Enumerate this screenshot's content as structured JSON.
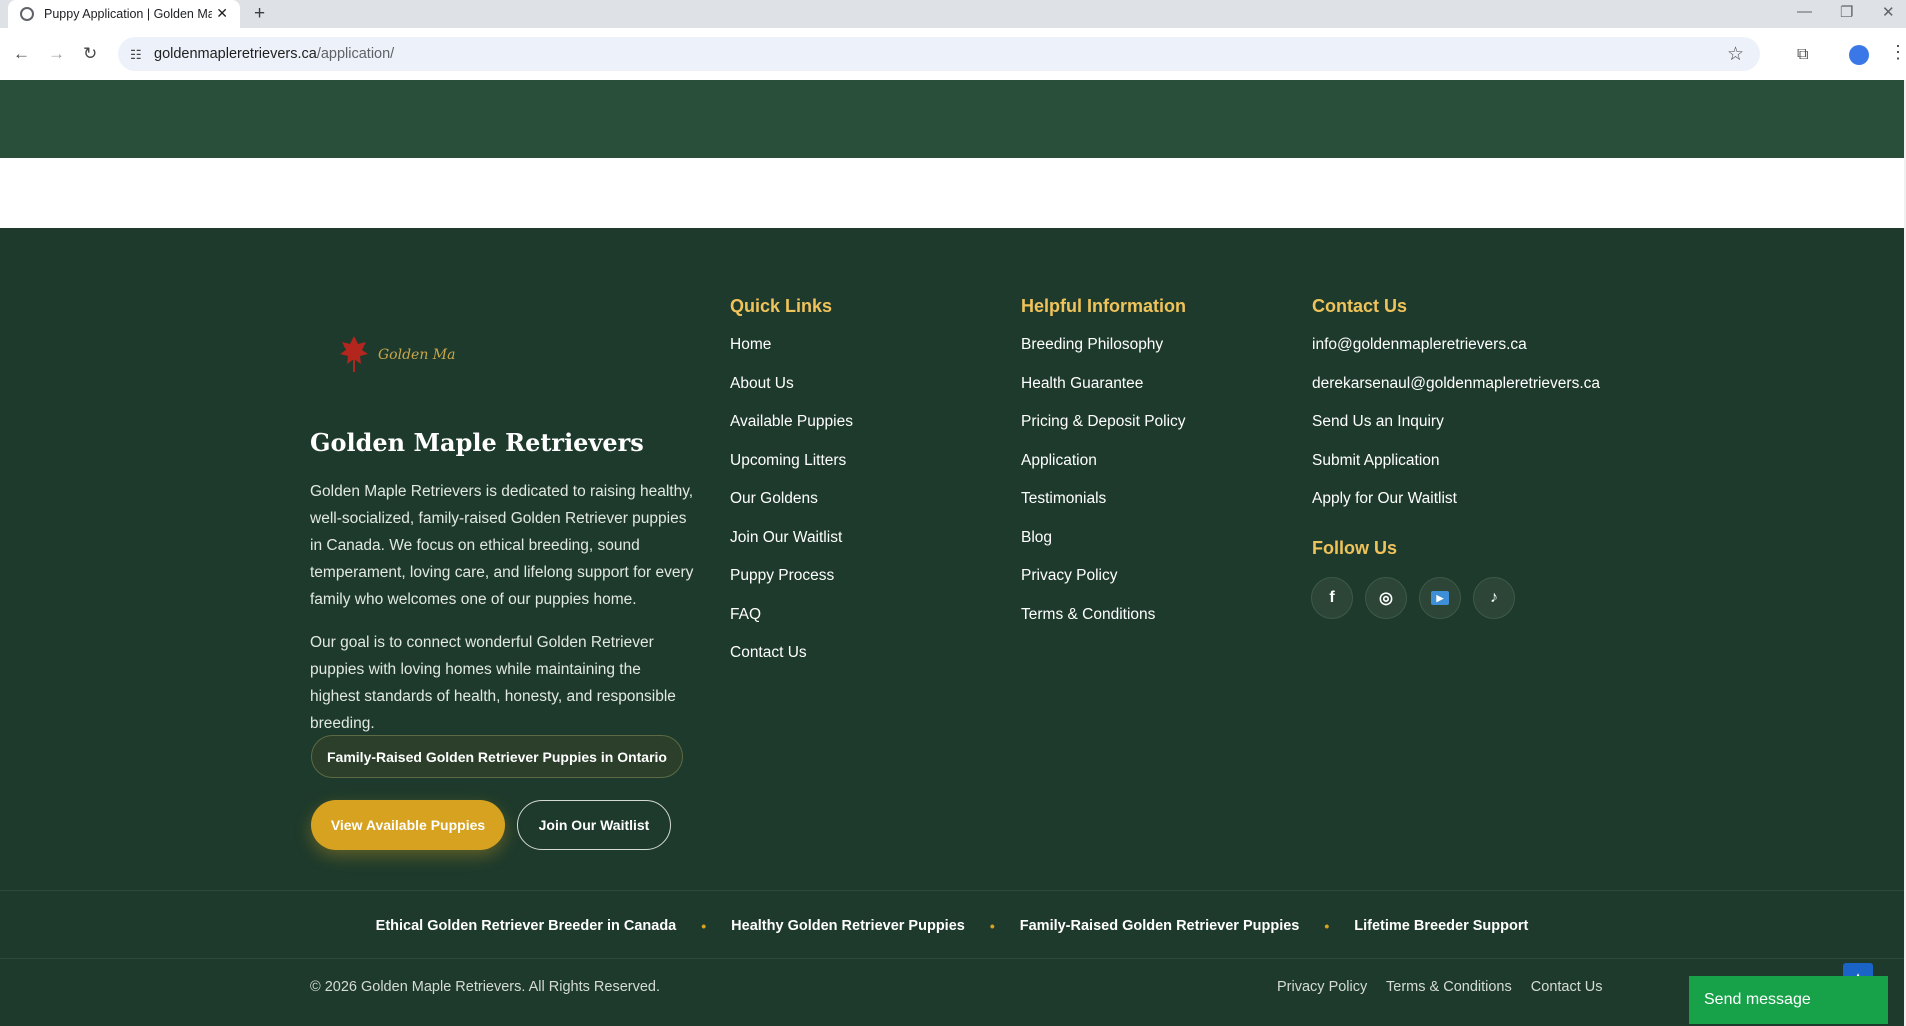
{
  "browser": {
    "tab_title": "Puppy Application | Golden Ma",
    "tab_close": "✕",
    "new_tab": "+",
    "url_host": "goldenmapleretrievers.ca",
    "url_path": "/application/"
  },
  "footer": {
    "brand_title": "Golden Maple Retrievers",
    "logo_text": "Golden Maple",
    "about_p1": "Golden Maple Retrievers is dedicated to raising healthy, well-socialized, family-raised Golden Retriever puppies in Canada. We focus on ethical breeding, sound temperament, loving care, and lifelong support for every family who welcomes one of our puppies home.",
    "about_p2": "Our goal is to connect wonderful Golden Retriever puppies with loving homes while maintaining the highest standards of health, honesty, and responsible breeding.",
    "pill_label": "Family-Raised Golden Retriever Puppies in Ontario",
    "btn_view": "View Available Puppies",
    "btn_waitlist": "Join Our Waitlist",
    "quick_links": {
      "heading": "Quick Links",
      "items": [
        "Home",
        "About Us",
        "Available Puppies",
        "Upcoming Litters",
        "Our Goldens",
        "Join Our Waitlist",
        "Puppy Process",
        "FAQ",
        "Contact Us"
      ]
    },
    "helpful": {
      "heading": "Helpful Information",
      "items": [
        "Breeding Philosophy",
        "Health Guarantee",
        "Pricing & Deposit Policy",
        "Application",
        "Testimonials",
        "Blog",
        "Privacy Policy",
        "Terms & Conditions"
      ]
    },
    "contact": {
      "heading": "Contact Us",
      "items": [
        "info@goldenmapleretrievers.ca",
        "derekarsenaul@goldenmapleretrievers.ca",
        "Send Us an Inquiry",
        "Submit Application",
        "Apply for Our Waitlist"
      ]
    },
    "follow": {
      "heading": "Follow Us",
      "icons": [
        "facebook-icon",
        "instagram-icon",
        "youtube-icon",
        "tiktok-icon"
      ]
    },
    "taglines": [
      "Ethical Golden Retriever Breeder in Canada",
      "Healthy Golden Retriever Puppies",
      "Family-Raised Golden Retriever Puppies",
      "Lifetime Breeder Support"
    ],
    "copyright": "© 2026 Golden Maple Retrievers. All Rights Reserved.",
    "bottom_links": [
      "Privacy Policy",
      "Terms & Conditions",
      "Contact Us"
    ]
  },
  "widgets": {
    "send_message": "Send message"
  },
  "colors": {
    "hero_green": "#294f3a",
    "footer_green": "#1e3a2c",
    "gold_accent": "#d6a21f",
    "heading_gold": "#f0c35a",
    "send_green": "#17a24a"
  }
}
